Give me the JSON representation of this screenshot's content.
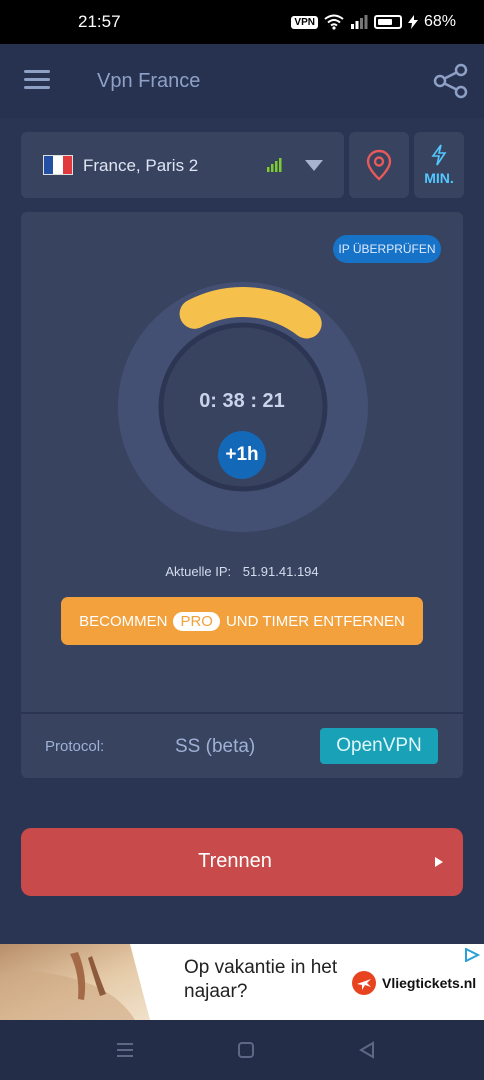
{
  "status_bar": {
    "time": "21:57",
    "vpn_label": "VPN",
    "battery_percent": "68%"
  },
  "app_bar": {
    "title": "Vpn France"
  },
  "server": {
    "name": "France,  Paris 2",
    "signal_level": 4
  },
  "mode": {
    "label": "MIN."
  },
  "ip_check": {
    "label": "IP ÜBERPRÜFEN"
  },
  "timer": {
    "time": "0: 38 : 21",
    "add_label": "+1h",
    "progress_fraction": 0.18
  },
  "ip": {
    "label": "Aktuelle IP:",
    "value": "51.91.41.194"
  },
  "pro_banner": {
    "prefix": "BECOMMEN",
    "badge": "PRO",
    "suffix": "UND TIMER ENTFERNEN"
  },
  "protocol": {
    "label": "Protocol:",
    "options": [
      "SS (beta)",
      "OpenVPN"
    ],
    "selected": "OpenVPN"
  },
  "disconnect": {
    "label": "Trennen"
  },
  "ad": {
    "text": "Op vakantie in het najaar?",
    "brand": "Vliegtickets.nl"
  },
  "colors": {
    "background": "#2a3553",
    "card": "#38435f",
    "accent_blue": "#1673c7",
    "timer_arc": "#f6c04c",
    "pro_orange": "#f2a13d",
    "openvpn_teal": "#19a1b7",
    "disconnect_red": "#c94a4a"
  },
  "icons": [
    "menu-icon",
    "share-icon",
    "france-flag-icon",
    "signal-icon",
    "chevron-down-icon",
    "location-pin-icon",
    "lightning-icon",
    "play-icon",
    "adchoices-icon",
    "recent-apps-icon",
    "home-icon",
    "back-icon"
  ]
}
